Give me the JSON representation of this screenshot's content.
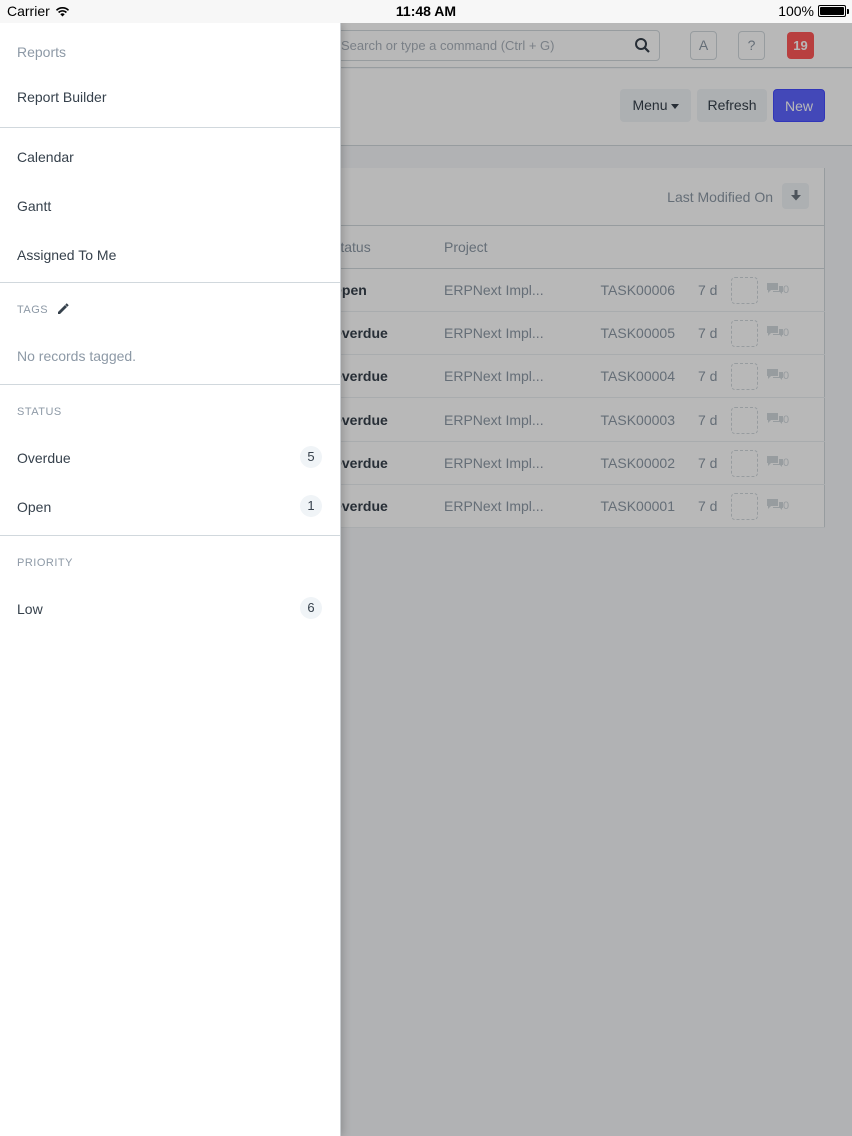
{
  "status_bar": {
    "carrier": "Carrier",
    "time": "11:48 AM",
    "battery": "100%"
  },
  "navbar": {
    "search_placeholder": "Search or type a command (Ctrl + G)",
    "avatar_letter": "A",
    "help_label": "?",
    "notification_count": "19"
  },
  "page_head": {
    "menu_label": "Menu",
    "refresh_label": "Refresh",
    "new_label": "New",
    "primary_color": "#5e64ff"
  },
  "list": {
    "sort_label": "Last Modified On",
    "headers": {
      "status": "Status",
      "project": "Project"
    },
    "rows": [
      {
        "status": "Open",
        "project": "ERPNext Impl...",
        "name": "TASK00006",
        "age": "7 d",
        "comments": "0"
      },
      {
        "status": "Overdue",
        "project": "ERPNext Impl...",
        "name": "TASK00005",
        "age": "7 d",
        "comments": "0"
      },
      {
        "status": "Overdue",
        "project": "ERPNext Impl...",
        "name": "TASK00004",
        "age": "7 d",
        "comments": "0"
      },
      {
        "status": "Overdue",
        "project": "ERPNext Impl...",
        "name": "TASK00003",
        "age": "7 d",
        "comments": "0"
      },
      {
        "status": "Overdue",
        "project": "ERPNext Impl...",
        "name": "TASK00002",
        "age": "7 d",
        "comments": "0"
      },
      {
        "status": "Overdue",
        "project": "ERPNext Impl...",
        "name": "TASK00001",
        "age": "7 d",
        "comments": "0"
      }
    ]
  },
  "drawer": {
    "reports": "Reports",
    "report_builder": "Report Builder",
    "calendar": "Calendar",
    "gantt": "Gantt",
    "assigned_to_me": "Assigned To Me",
    "tags_heading": "TAGS",
    "no_tags": "No records tagged.",
    "status_heading": "STATUS",
    "status_items": [
      {
        "label": "Overdue",
        "count": "5"
      },
      {
        "label": "Open",
        "count": "1"
      }
    ],
    "priority_heading": "PRIORITY",
    "priority_items": [
      {
        "label": "Low",
        "count": "6"
      }
    ]
  }
}
